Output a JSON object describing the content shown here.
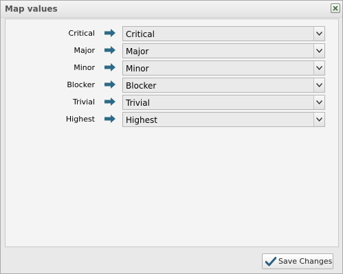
{
  "dialog": {
    "title": "Map values",
    "close_icon": "close-icon"
  },
  "mappings": [
    {
      "label": "Critical",
      "value": "Critical"
    },
    {
      "label": "Major",
      "value": "Major"
    },
    {
      "label": "Minor",
      "value": "Minor"
    },
    {
      "label": "Blocker",
      "value": "Blocker"
    },
    {
      "label": "Trivial",
      "value": "Trivial"
    },
    {
      "label": "Highest",
      "value": "Highest"
    }
  ],
  "icons": {
    "arrow": "arrow-right-icon",
    "dropdown": "chevron-down-icon",
    "save": "checkmark-icon"
  },
  "colors": {
    "arrow": "#2d6a87",
    "checkmark": "#2b5f80"
  },
  "footer": {
    "save_label": "Save Changes"
  }
}
